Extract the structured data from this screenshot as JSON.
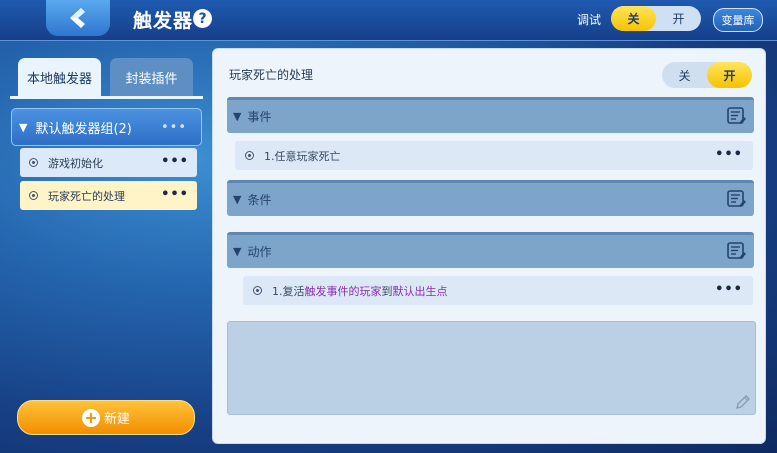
{
  "header": {
    "title": "触发器",
    "help_icon": "?",
    "debug_label": "调试",
    "debug_toggle": {
      "off": "关",
      "on": "开",
      "selected": "off"
    },
    "variable_library_label": "变量库"
  },
  "left_panel": {
    "tabs": [
      {
        "label": "本地触发器",
        "active": true
      },
      {
        "label": "封装插件",
        "active": false
      }
    ],
    "group": {
      "label": "默认触发器组(2)",
      "more": "•••"
    },
    "triggers": [
      {
        "label": "游戏初始化",
        "selected": false,
        "more": "•••"
      },
      {
        "label": "玩家死亡的处理",
        "selected": true,
        "more": "•••"
      }
    ],
    "new_button_label": "新建",
    "new_button_icon": "+"
  },
  "editor": {
    "trigger_name": "玩家死亡的处理",
    "enable_toggle": {
      "off": "关",
      "on": "开",
      "selected": "on"
    },
    "sections": {
      "event": {
        "label": "事件",
        "rows": [
          {
            "text": "1.任意玩家死亡",
            "more": "•••"
          }
        ]
      },
      "condition": {
        "label": "条件",
        "rows": []
      },
      "action": {
        "label": "动作",
        "rows": [
          {
            "prefix": "1.复活",
            "param1": "触发事件的玩家",
            "mid": "到",
            "param2": "默认出生点",
            "more": "•••"
          }
        ]
      }
    }
  },
  "colors": {
    "accent_yellow": "#f7c300",
    "param_purple": "#8a2fb0",
    "section_bar": "#7da4c9",
    "new_button": "#f28e00"
  }
}
